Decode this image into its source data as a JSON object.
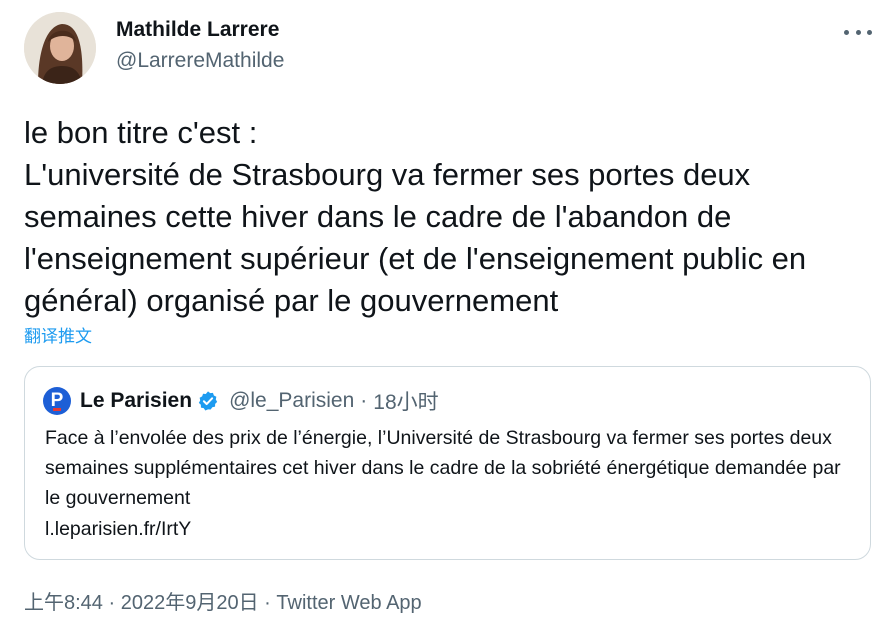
{
  "author": {
    "name": "Mathilde Larrere",
    "handle": "@LarrereMathilde"
  },
  "tweet": {
    "text": "le bon titre c'est :\nL'université de Strasbourg va fermer ses portes deux semaines cette hiver dans le cadre de l'abandon de l'enseignement supérieur (et de l'enseignement public en général) organisé par le gouvernement",
    "translate_label": "翻译推文"
  },
  "quoted": {
    "logo_letter": "P",
    "name": "Le Parisien",
    "handle": "@le_Parisien",
    "separator": "·",
    "time": "18小时",
    "text": "Face à l’envolée des prix de l’énergie, l’Université de Strasbourg va fermer ses portes deux semaines supplémentaires cet hiver dans le cadre de la sobriété énergétique demandée par le gouvernement",
    "link": "l.leparisien.fr/IrtY"
  },
  "meta": {
    "time": "上午8:44",
    "separator": "·",
    "date": "2022年9月20日",
    "separator2": "·",
    "source": "Twitter Web App"
  },
  "colors": {
    "text": "#0f1419",
    "secondary": "#536471",
    "link": "#1d9bf0",
    "border": "#cfd9de",
    "verified": "#1d9bf0",
    "parisien_blue": "#1d5fd6"
  },
  "icons": {
    "more": "more-horizontal-icon",
    "verified": "verified-badge-icon"
  }
}
